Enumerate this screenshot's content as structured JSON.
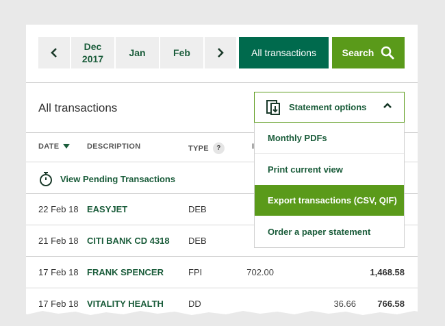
{
  "date_nav": {
    "prev_label": "‹",
    "month1_line1": "Dec",
    "month1_line2": "2017",
    "month2": "Jan",
    "month3": "Feb",
    "next_label": "›",
    "all_transactions": "All transactions",
    "search": "Search"
  },
  "section": {
    "title": "All transactions",
    "statement_options": "Statement options"
  },
  "columns": {
    "date": "DATE",
    "description": "DESCRIPTION",
    "type": "TYPE",
    "type_help": "?",
    "partial": "I"
  },
  "pending_label": "View Pending Transactions",
  "rows": [
    {
      "date": "22 Feb 18",
      "description": "EASYJET",
      "type": "DEB",
      "out": "",
      "in": "",
      "balance": ""
    },
    {
      "date": "21 Feb 18",
      "description": "CITI BANK CD 4318",
      "type": "DEB",
      "out": "",
      "in": "",
      "balance": ""
    },
    {
      "date": "17 Feb 18",
      "description": "FRANK SPENCER",
      "type": "FPI",
      "out": "702.00",
      "in": "",
      "balance": "1,468.58"
    },
    {
      "date": "17 Feb 18",
      "description": "VITALITY HEALTH",
      "type": "DD",
      "out": "",
      "in": "36.66",
      "balance": "766.58"
    }
  ],
  "dropdown": {
    "items": [
      {
        "label": "Monthly PDFs",
        "active": false
      },
      {
        "label": "Print current view",
        "active": false
      },
      {
        "label": "Export transactions (CSV, QIF)",
        "active": true
      },
      {
        "label": "Order a paper statement",
        "active": false
      }
    ]
  },
  "colors": {
    "dark_green": "#006a4d",
    "bright_green": "#5a9a1a",
    "link_green": "#1a5c3a",
    "background": "#e9e9e9"
  }
}
